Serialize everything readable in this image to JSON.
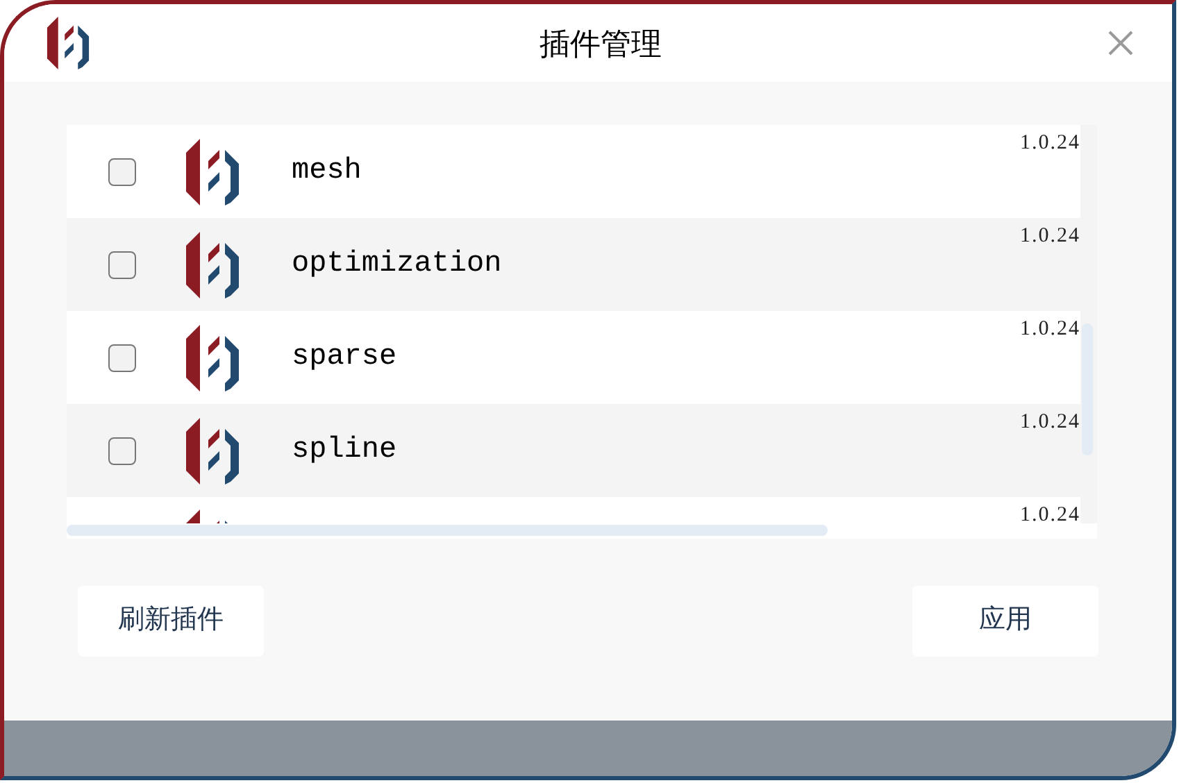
{
  "window": {
    "title": "插件管理"
  },
  "plugins": [
    {
      "name": "mesh",
      "version": "1.0.24",
      "checked": false
    },
    {
      "name": "optimization",
      "version": "1.0.24",
      "checked": false
    },
    {
      "name": "sparse",
      "version": "1.0.24",
      "checked": false
    },
    {
      "name": "spline",
      "version": "1.0.24",
      "checked": false
    },
    {
      "version": "1.0.24"
    }
  ],
  "buttons": {
    "refresh": "刷新插件",
    "apply": "应用"
  }
}
